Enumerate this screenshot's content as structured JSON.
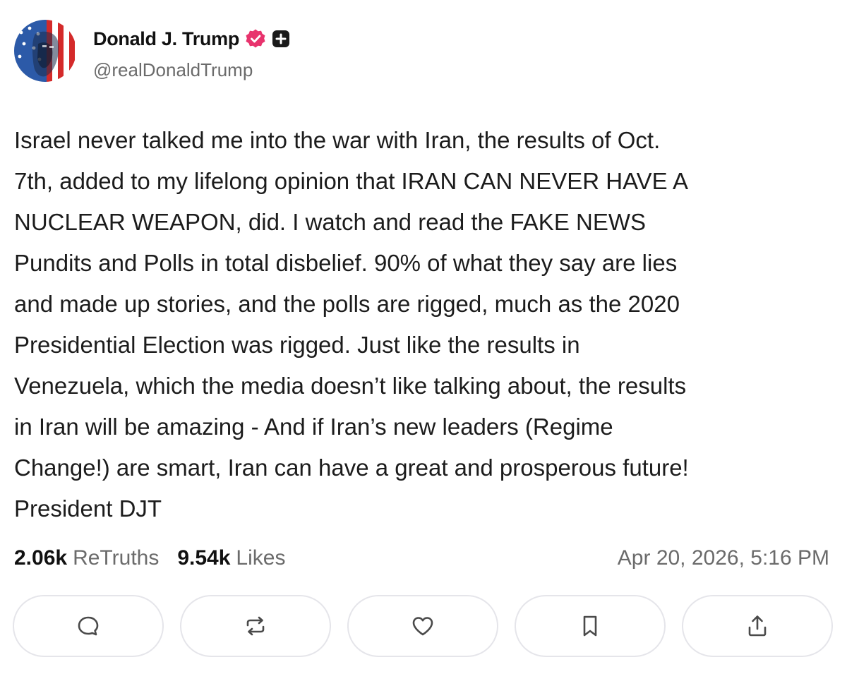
{
  "author": {
    "display_name": "Donald J. Trump",
    "handle": "@realDonaldTrump",
    "verified_icon": "verified-badge-icon",
    "plus_icon": "plus-badge-icon"
  },
  "post": {
    "text": "Israel never talked me into the war with Iran, the results of Oct.\n7th, added to my lifelong opinion that IRAN CAN NEVER HAVE A\nNUCLEAR WEAPON, did. I watch and read the FAKE NEWS\nPundits and Polls in total disbelief. 90% of what they say are lies\nand made up stories, and the polls are rigged, much as the 2020\nPresidential Election was rigged. Just like the results in\nVenezuela, which the media doesn’t like talking about, the results\nin Iran will be amazing - And if Iran’s new leaders (Regime\nChange!) are smart, Iran can have a great and prosperous future!\nPresident DJT"
  },
  "stats": {
    "retruths_count": "2.06k",
    "retruths_label": "ReTruths",
    "likes_count": "9.54k",
    "likes_label": "Likes",
    "timestamp": "Apr 20, 2026, 5:16 PM"
  },
  "actions": [
    {
      "icon": "reply-icon"
    },
    {
      "icon": "retruth-icon"
    },
    {
      "icon": "like-icon"
    },
    {
      "icon": "bookmark-icon"
    },
    {
      "icon": "share-icon"
    }
  ],
  "colors": {
    "verified_badge": "#e8336d",
    "text_primary": "#111111",
    "text_secondary": "#6b6b6b",
    "button_border": "#e5e5ea"
  }
}
